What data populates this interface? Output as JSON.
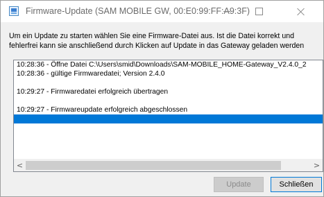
{
  "window": {
    "title": "Firmware-Update (SAM MOBILE GW, 00:E0:99:FF:A9:3F)"
  },
  "titlebar_buttons": {
    "minimize_icon": "minimize-icon",
    "maximize_icon": "maximize-icon",
    "close_icon": "close-icon"
  },
  "instructions": {
    "line1": "Um ein Update zu starten wählen Sie eine Firmware-Datei aus. Ist die Datei korrekt und",
    "line2": "fehlerfrei kann sie anschließend durch Klicken auf Update in das Gateway geladen werden"
  },
  "log": {
    "lines": [
      "10:28:36 - Öffne Datei C:\\Users\\smid\\Downloads\\SAM-MOBILE_HOME-Gateway_V2.4.0_2",
      "10:28:36 - gültige Firmwaredatei; Version 2.4.0",
      "",
      "10:29:27 - Firmwaredatei erfolgreich übertragen",
      "",
      "10:29:27 - Firmwareupdate erfolgreich abgeschlossen",
      ""
    ],
    "selected_index": 6
  },
  "scrollbar": {
    "left_arrow": "<",
    "right_arrow": ">"
  },
  "buttons": {
    "update": "Update",
    "close": "Schließen"
  },
  "colors": {
    "selection": "#0078d7",
    "focus_border": "#0078d7"
  }
}
